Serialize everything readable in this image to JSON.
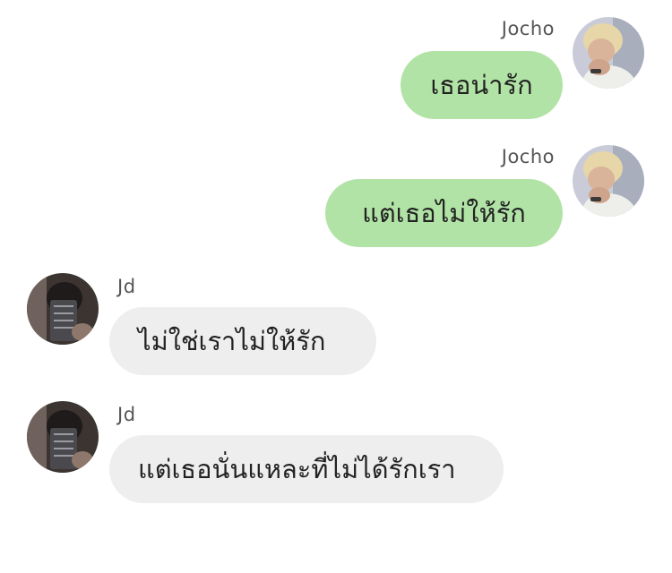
{
  "messages": [
    {
      "sender": "Jocho",
      "text": "เธอน่ารัก",
      "direction": "outgoing",
      "avatar": "blonde-person-avatar"
    },
    {
      "sender": "Jocho",
      "text": "แต่เธอไม่ให้รัก",
      "direction": "outgoing",
      "avatar": "blonde-person-avatar"
    },
    {
      "sender": "Jd",
      "text": "ไม่ใช่เราไม่ให้รัก",
      "direction": "incoming",
      "avatar": "dark-hair-person-avatar"
    },
    {
      "sender": "Jd",
      "text": "แต่เธอนั่นแหละที่ไม่ได้รักเรา",
      "direction": "incoming",
      "avatar": "dark-hair-person-avatar"
    }
  ],
  "colors": {
    "outgoing_bubble": "#b2e3a6",
    "incoming_bubble": "#eeeeee",
    "name_text": "#555555",
    "message_text": "#222222"
  }
}
